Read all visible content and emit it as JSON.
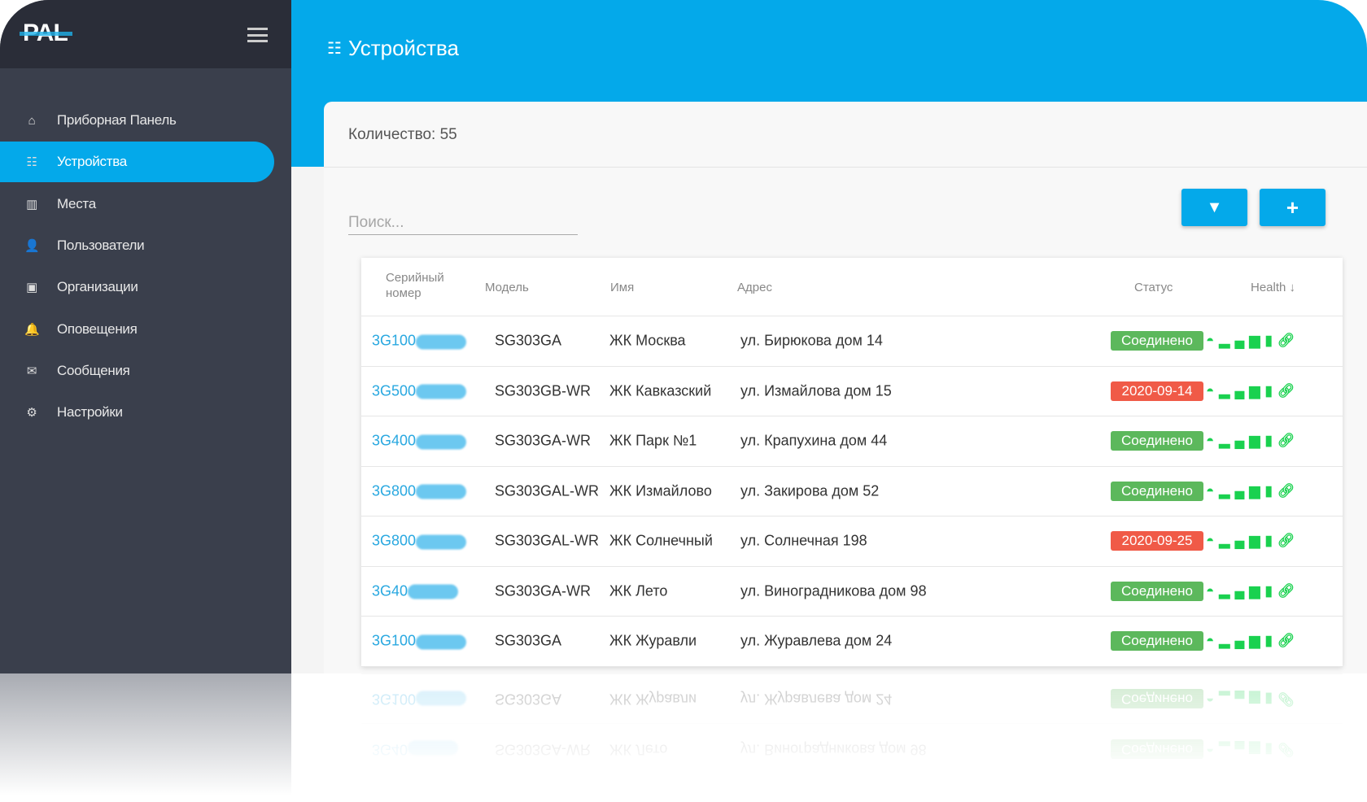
{
  "brand": "PAL",
  "sidebar": {
    "items": [
      {
        "label": "Приборная Панель",
        "icon": "home-icon",
        "glyph": "⌂"
      },
      {
        "label": "Устройства",
        "icon": "router-icon",
        "glyph": "☷",
        "active": true
      },
      {
        "label": "Места",
        "icon": "map-icon",
        "glyph": "▥"
      },
      {
        "label": "Пользователи",
        "icon": "user-icon",
        "glyph": "👤"
      },
      {
        "label": "Организации",
        "icon": "briefcase-icon",
        "glyph": "▣"
      },
      {
        "label": "Оповещения",
        "icon": "bell-icon",
        "glyph": "🔔"
      },
      {
        "label": "Сообщения",
        "icon": "envelope-icon",
        "glyph": "✉"
      },
      {
        "label": "Настройки",
        "icon": "gear-icon",
        "glyph": "⚙"
      }
    ]
  },
  "header": {
    "title": "Устройства"
  },
  "main": {
    "count_label": "Количество: 55",
    "search_placeholder": "Поиск...",
    "filter_icon": "filter-icon",
    "add_icon": "plus-icon",
    "columns": [
      "Серийный номер",
      "Модель",
      "Имя",
      "Адрес",
      "Статус",
      "Health"
    ],
    "sort_icon": "arrow-down-icon",
    "rows": [
      {
        "serial": "3G100",
        "model": "SG303GA",
        "name": "ЖК Москва",
        "address": "ул. Бирюкова дом 14",
        "status": "Соединено",
        "status_type": "ok"
      },
      {
        "serial": "3G500",
        "model": "SG303GB-WR",
        "name": "ЖК Кавказский",
        "address": "ул. Измайлова дом 15",
        "status": "2020-09-14",
        "status_type": "error"
      },
      {
        "serial": "3G400",
        "model": "SG303GA-WR",
        "name": "ЖК Парк №1",
        "address": "ул. Крапухина дом 44",
        "status": "Соединено",
        "status_type": "ok"
      },
      {
        "serial": "3G800",
        "model": "SG303GAL-WR",
        "name": "ЖК Измайлово",
        "address": "ул. Закирова дом 52",
        "status": "Соединено",
        "status_type": "ok"
      },
      {
        "serial": "3G800",
        "model": "SG303GAL-WR",
        "name": "ЖК Солнечный",
        "address": "ул. Солнечная 198",
        "status": "2020-09-25",
        "status_type": "error"
      },
      {
        "serial": "3G40",
        "model": "SG303GA-WR",
        "name": "ЖК Лето",
        "address": "ул. Виноградникова дом 98",
        "status": "Соединено",
        "status_type": "ok"
      },
      {
        "serial": "3G100",
        "model": "SG303GA",
        "name": "ЖК Журавли",
        "address": "ул. Журавлева дом 24",
        "status": "Соединено",
        "status_type": "ok"
      }
    ],
    "health_icons": [
      "gauge-icon",
      "signal-icon",
      "battery-icon",
      "link-icon"
    ]
  },
  "colors": {
    "accent": "#04a9ea",
    "ok": "#5cb85c",
    "error": "#f05a47",
    "health": "#1ad14f",
    "sidebar": "#3a3f4c"
  }
}
